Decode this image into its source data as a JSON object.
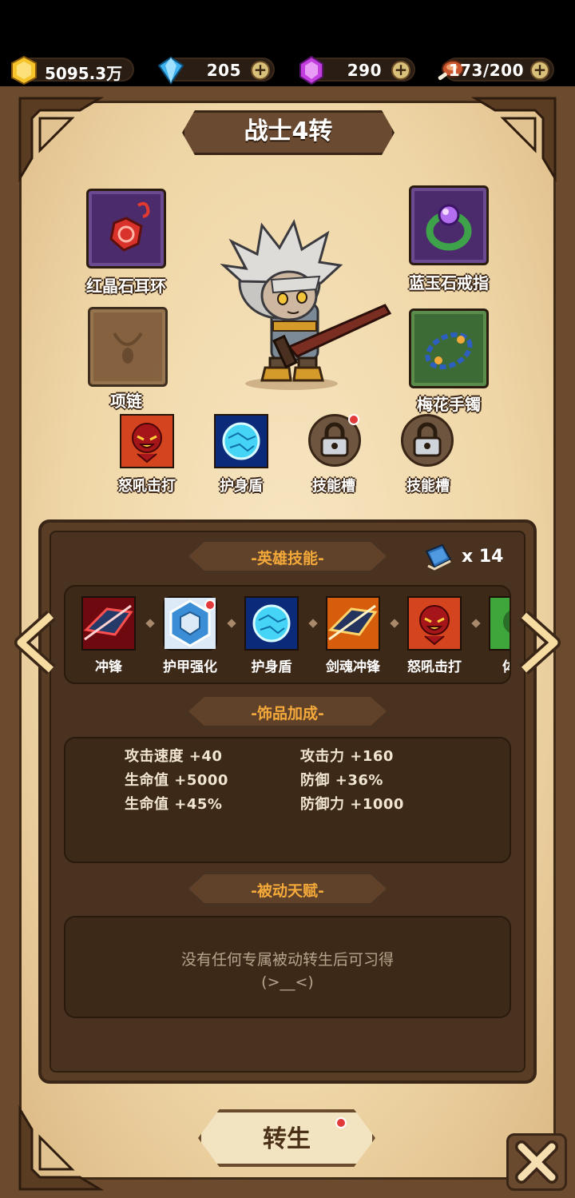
{
  "resources": {
    "gold": "5095.3万",
    "diamond": "205",
    "gem": "290",
    "stamina": "173/200"
  },
  "title": "战士4转",
  "equipment": {
    "left_top": "红晶石耳环",
    "left_bottom": "项链",
    "right_top": "蓝玉石戒指",
    "right_bottom": "梅花手镯"
  },
  "skill_slots": [
    "怒吼击打",
    "护身盾",
    "技能槽",
    "技能槽"
  ],
  "hero_skills": {
    "title": "-英雄技能-",
    "book_count": "x 14",
    "items": [
      "冲锋",
      "护甲强化",
      "护身盾",
      "剑魂冲锋",
      "怒吼击打",
      "体质"
    ]
  },
  "accessory_bonus": {
    "title": "-饰品加成-",
    "stats": [
      "攻击速度 +40",
      "攻击力 +160",
      "生命值 +5000",
      "防御 +36%",
      "生命值 +45%",
      "防御力 +1000"
    ]
  },
  "passive_talent": {
    "title": "-被动天赋-",
    "line1": "没有任何专属被动转生后可习得",
    "line2": "(>__<)"
  },
  "rebirth_button": "转生"
}
